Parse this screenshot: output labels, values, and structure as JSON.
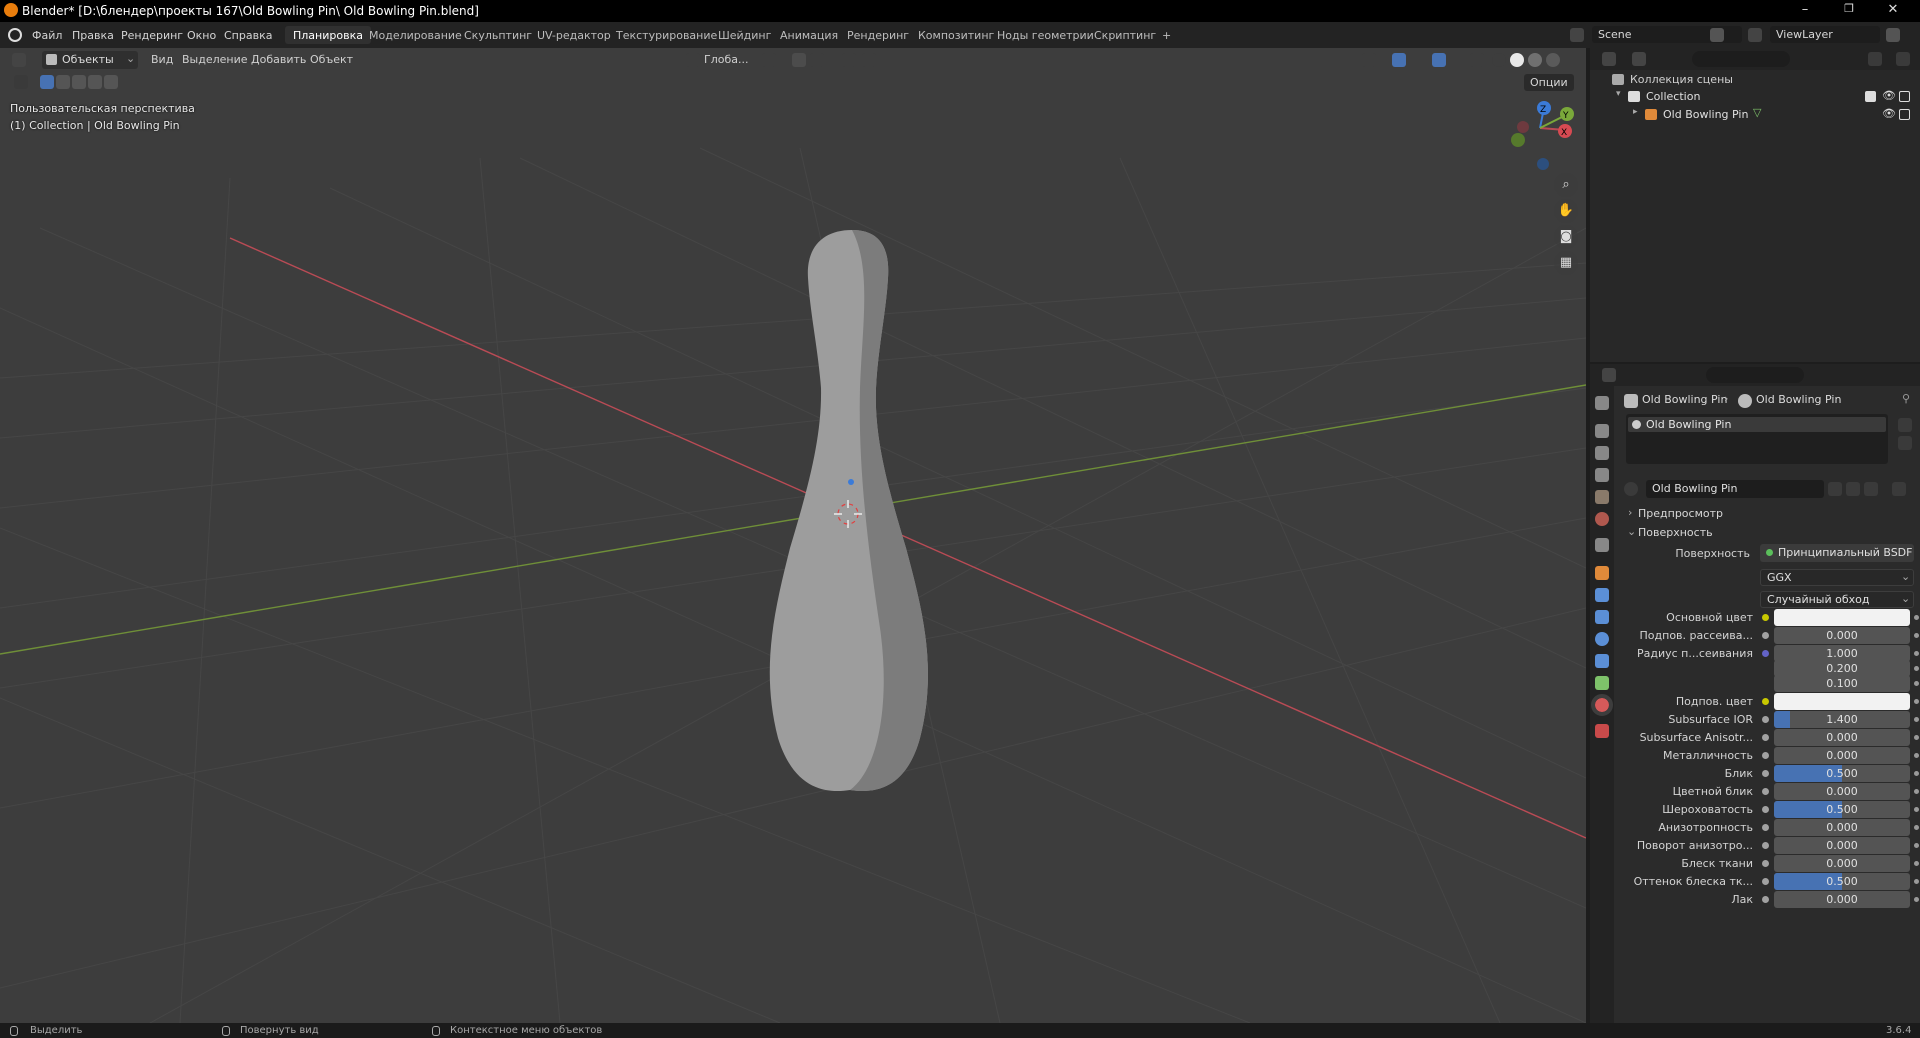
{
  "window": {
    "title": "Blender* [D:\\блендер\\проекты 167\\Old Bowling Pin\\ Old Bowling Pin.blend]",
    "min": "–",
    "restore": "❐",
    "close": "✕"
  },
  "menu": {
    "items": [
      "Файл",
      "Правка",
      "Рендеринг",
      "Окно",
      "Справка"
    ]
  },
  "workspaces": [
    "Планировка",
    "Моделирование",
    "Скульптинг",
    "UV-редактор",
    "Текстурирование",
    "Шейдинг",
    "Анимация",
    "Рендеринг",
    "Композитинг",
    "Ноды геометрии",
    "Скриптинг",
    "+"
  ],
  "scene": {
    "name": "Scene",
    "view_layer": "ViewLayer"
  },
  "viewport_header": {
    "mode": "Объекты",
    "menus": [
      "Вид",
      "Выделение",
      "Добавить",
      "Объект"
    ],
    "transform": "Глоба...",
    "options": "Опции"
  },
  "viewport": {
    "perspective": "Пользовательская перспектива",
    "collection": "(1) Collection | Old Bowling Pin",
    "gizmo": {
      "x": "X",
      "y": "Y",
      "z": "Z"
    }
  },
  "outliner": {
    "root": "Коллекция сцены",
    "collection": "Collection",
    "object": "Old Bowling Pin"
  },
  "properties": {
    "breadcrumb_object": "Old Bowling Pin",
    "breadcrumb_material": "Old Bowling Pin",
    "slot": "Old Bowling Pin",
    "material_name": "Old Bowling Pin",
    "preview_section": "Предпросмотр",
    "surface_section": "Поверхность",
    "surface_label": "Поверхность",
    "surface_shader": "Принципиальный BSDF",
    "distribution": "GGX",
    "subsurface_method": "Случайный обход",
    "rows": [
      {
        "label": "Основной цвет",
        "value": "",
        "type": "color",
        "color": "#f2f2f2",
        "socket": "#c8c800"
      },
      {
        "label": "Подпов. рассеива...",
        "value": "0.000",
        "type": "num",
        "fill": 0,
        "socket": "#a1a1a1"
      },
      {
        "label": "Радиус п...сеивания",
        "value": "1.000",
        "type": "num",
        "fill": 0,
        "socket": "#6363c7"
      },
      {
        "label": "",
        "value": "0.200",
        "type": "num",
        "fill": 0,
        "socket": ""
      },
      {
        "label": "",
        "value": "0.100",
        "type": "num",
        "fill": 0,
        "socket": ""
      },
      {
        "label": "Подпов. цвет",
        "value": "",
        "type": "color",
        "color": "#f2f2f2",
        "socket": "#c8c800"
      },
      {
        "label": "Subsurface IOR",
        "value": "1.400",
        "type": "num",
        "fill": 0.12,
        "socket": "#a1a1a1"
      },
      {
        "label": "Subsurface Anisotr...",
        "value": "0.000",
        "type": "num",
        "fill": 0,
        "socket": "#a1a1a1"
      },
      {
        "label": "Металличность",
        "value": "0.000",
        "type": "num",
        "fill": 0,
        "socket": "#a1a1a1"
      },
      {
        "label": "Блик",
        "value": "0.500",
        "type": "num",
        "fill": 0.5,
        "socket": "#a1a1a1"
      },
      {
        "label": "Цветной блик",
        "value": "0.000",
        "type": "num",
        "fill": 0,
        "socket": "#a1a1a1"
      },
      {
        "label": "Шероховатость",
        "value": "0.500",
        "type": "num",
        "fill": 0.5,
        "socket": "#a1a1a1"
      },
      {
        "label": "Анизотропность",
        "value": "0.000",
        "type": "num",
        "fill": 0,
        "socket": "#a1a1a1"
      },
      {
        "label": "Поворот анизотро...",
        "value": "0.000",
        "type": "num",
        "fill": 0,
        "socket": "#a1a1a1"
      },
      {
        "label": "Блеск ткани",
        "value": "0.000",
        "type": "num",
        "fill": 0,
        "socket": "#a1a1a1"
      },
      {
        "label": "Оттенок блеска тк...",
        "value": "0.500",
        "type": "num",
        "fill": 0.5,
        "socket": "#a1a1a1"
      },
      {
        "label": "Лак",
        "value": "0.000",
        "type": "num",
        "fill": 0,
        "socket": "#a1a1a1"
      }
    ]
  },
  "status": {
    "select": "Выделить",
    "rotate": "Повернуть вид",
    "context": "Контекстное меню объектов",
    "version": "3.6.4"
  },
  "colors": {
    "accent": "#4772b3",
    "grid": "#4a4a4a",
    "x_axis": "#c0404a",
    "y_axis": "#7aa83a",
    "brand": "#e87d0d"
  }
}
